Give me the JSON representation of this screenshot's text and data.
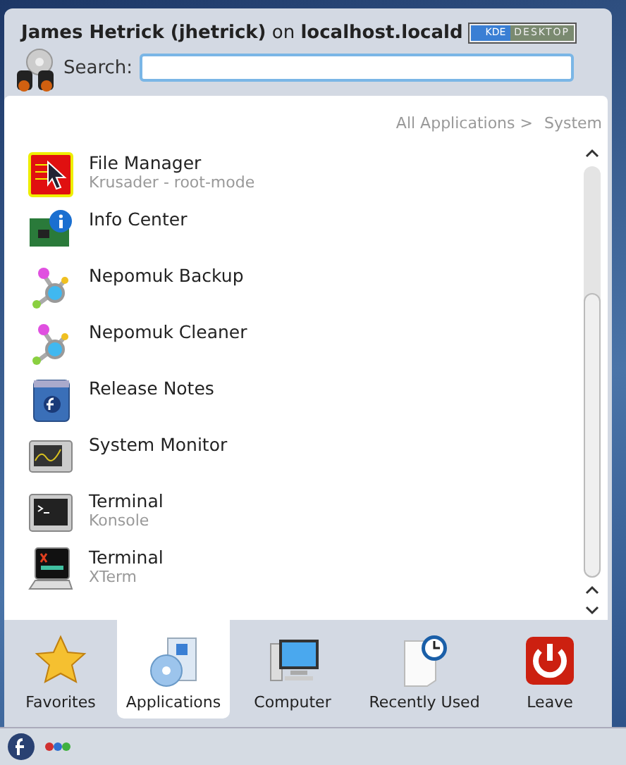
{
  "header": {
    "title": "**James Hetrick (jhetrick)** on **localhost.locald**",
    "badge": [
      "KDE",
      "DESKTOP"
    ]
  },
  "search": {
    "label": "Search:"
  },
  "breadcrumb": [
    "All Applications >",
    "System"
  ],
  "items": [
    {
      "title": "File Manager",
      "subtitle": "Krusader - root-mode"
    },
    {
      "title": "Info Center"
    },
    {
      "title": "Nepomuk Backup"
    },
    {
      "title": "Nepomuk Cleaner"
    },
    {
      "title": "Release Notes"
    },
    {
      "title": "System Monitor"
    },
    {
      "title": "Terminal",
      "subtitle": "Konsole"
    },
    {
      "title": "Terminal",
      "subtitle": "XTerm"
    }
  ],
  "tabs": [
    {
      "label": "Favorites",
      "selected": false
    },
    {
      "label": "Applications",
      "selected": true
    },
    {
      "label": "Computer",
      "selected": false
    },
    {
      "label": "Recently Used",
      "selected": false
    },
    {
      "label": "Leave",
      "selected": false
    }
  ]
}
